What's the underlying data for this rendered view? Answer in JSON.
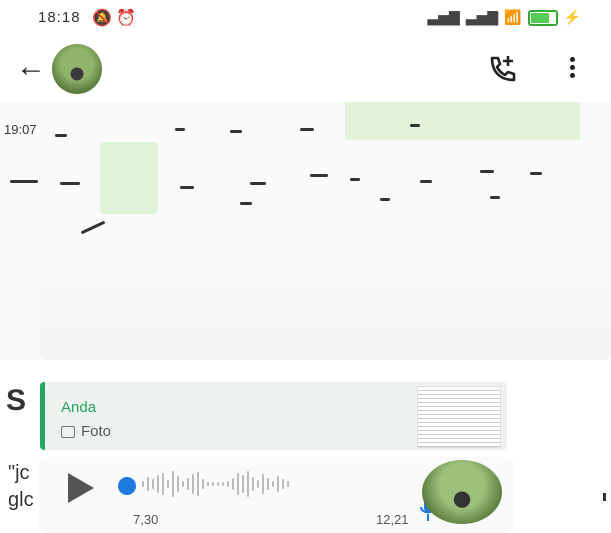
{
  "status_bar": {
    "time": "18:18",
    "left_icons": [
      "mute-icon",
      "alarm-icon"
    ],
    "right_icons": [
      "signal-icon",
      "signal-icon",
      "wifi-icon",
      "battery-icon",
      "charging-icon"
    ]
  },
  "header": {
    "contact_name": "",
    "actions": [
      "add-call-icon",
      "more-options-icon"
    ]
  },
  "media": {
    "time_prefix": "19:07"
  },
  "partial_text": {
    "heading_letter": "S",
    "line1": "\"jc",
    "line2": "glc"
  },
  "reply": {
    "sender": "Anda",
    "type_label": "Foto"
  },
  "audio": {
    "position_label": "7,30",
    "duration_label": "12,21",
    "progress": 0.0
  },
  "colors": {
    "accent_green": "#25a560",
    "audio_blue": "#1f7ae0"
  }
}
